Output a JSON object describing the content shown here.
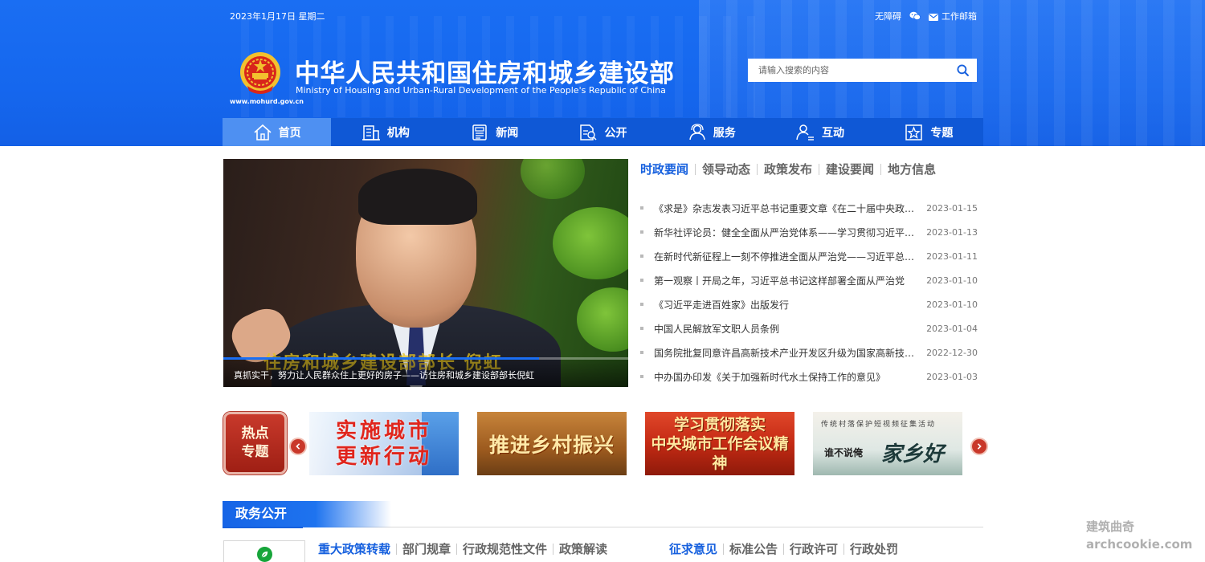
{
  "header": {
    "date": "2023年1月17日 星期二",
    "accessibility": "无障碍",
    "mail_label": "工作邮箱",
    "site_title": "中华人民共和国住房和城乡建设部",
    "site_subtitle": "Ministry of Housing and Urban-Rural Development of the People's Republic of China",
    "logo_url": "www.mohurd.gov.cn",
    "search_placeholder": "请输入搜索的内容",
    "bg_color": "#1a6ef3"
  },
  "nav": {
    "items": [
      {
        "label": "首页",
        "icon": "home-icon",
        "active": true
      },
      {
        "label": "机构",
        "icon": "building-icon"
      },
      {
        "label": "新闻",
        "icon": "newspaper-icon"
      },
      {
        "label": "公开",
        "icon": "document-icon"
      },
      {
        "label": "服务",
        "icon": "service-icon"
      },
      {
        "label": "互动",
        "icon": "interaction-icon"
      },
      {
        "label": "专题",
        "icon": "star-badge-icon"
      }
    ],
    "bg_color": "#0f58d6",
    "active_color": "#4e90f2"
  },
  "slider": {
    "overlay_title": "住房和城乡建设部部长 倪虹",
    "caption": "真抓实干，努力让人民群众住上更好的房子——访住房和城乡建设部部长倪虹",
    "progress": 0.78
  },
  "news": {
    "tabs": [
      "时政要闻",
      "领导动态",
      "政策发布",
      "建设要闻",
      "地方信息"
    ],
    "items": [
      {
        "title": "《求是》杂志发表习近平总书记重要文章《在二十届中央政治局第一次集体学习时的讲话》",
        "date": "2023-01-15"
      },
      {
        "title": "新华社评论员：健全全面从严治党体系——学习贯彻习近平总书记在二十届中央纪委二次全会上重要讲话",
        "date": "2023-01-13"
      },
      {
        "title": "在新时代新征程上一刻不停推进全面从严治党——习近平总书记重要讲话",
        "date": "2023-01-11"
      },
      {
        "title": "第一观察丨开局之年，习近平总书记这样部署全面从严治党",
        "date": "2023-01-10"
      },
      {
        "title": "《习近平走进百姓家》出版发行",
        "date": "2023-01-10"
      },
      {
        "title": "中国人民解放军文职人员条例",
        "date": "2023-01-04"
      },
      {
        "title": "国务院批复同意许昌高新技术产业开发区升级为国家高新技术产业开发区",
        "date": "2022-12-30"
      },
      {
        "title": "中办国办印发《关于加强新时代水土保持工作的意见》",
        "date": "2023-01-03"
      }
    ]
  },
  "hot_topics": {
    "badge_line1": "热点",
    "badge_line2": "专题",
    "banners": [
      {
        "line1": "实施城市",
        "line2": "更新行动"
      },
      {
        "line1": "推进乡村振兴"
      },
      {
        "line1": "学习贯彻落实",
        "line2": "中央城市工作会议精神"
      },
      {
        "small": "传统村落保护短视频征集活动",
        "sub": "谁不说俺",
        "main": "家乡好"
      }
    ]
  },
  "zhengwu": {
    "title": "政务公开",
    "left_tabs": [
      "重大政策转载",
      "部门规章",
      "行政规范性文件",
      "政策解读"
    ],
    "right_tabs": [
      "征求意见",
      "标准公告",
      "行政许可",
      "行政处罚"
    ]
  },
  "watermark": {
    "line1": "建筑曲奇",
    "line2": "archcookie.com"
  }
}
